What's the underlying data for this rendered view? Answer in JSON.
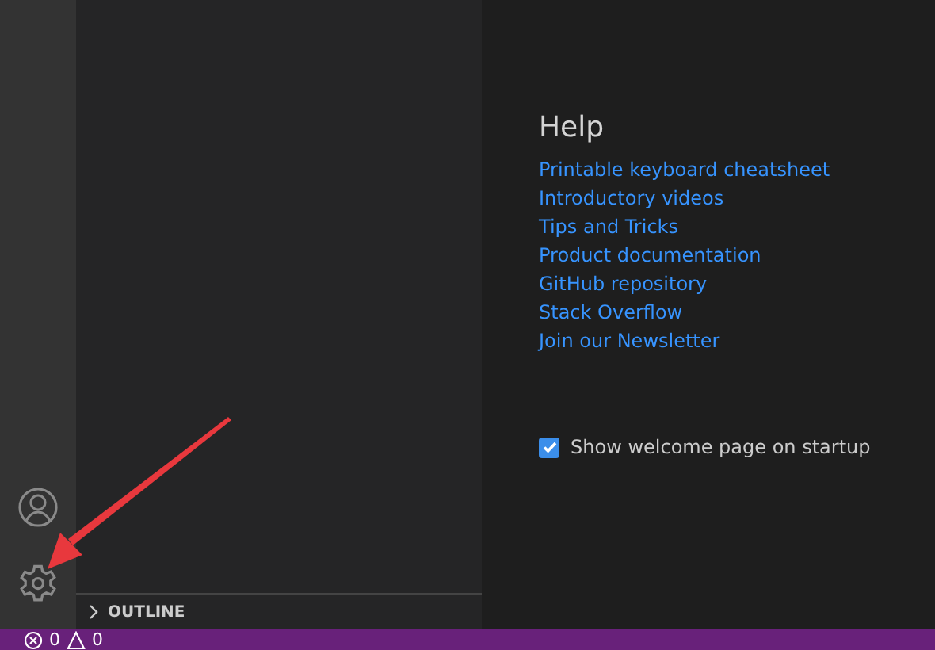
{
  "sidebar": {
    "sections": [
      {
        "title": "OUTLINE",
        "expanded": false
      }
    ]
  },
  "help": {
    "title": "Help",
    "links": [
      {
        "label": "Printable keyboard cheatsheet"
      },
      {
        "label": "Introductory videos"
      },
      {
        "label": "Tips and Tricks"
      },
      {
        "label": "Product documentation"
      },
      {
        "label": "GitHub repository"
      },
      {
        "label": "Stack Overflow"
      },
      {
        "label": "Join our Newsletter"
      }
    ]
  },
  "startup_checkbox": {
    "label": "Show welcome page on startup",
    "checked": true
  },
  "status_bar": {
    "errors": "0",
    "warnings": "0"
  }
}
